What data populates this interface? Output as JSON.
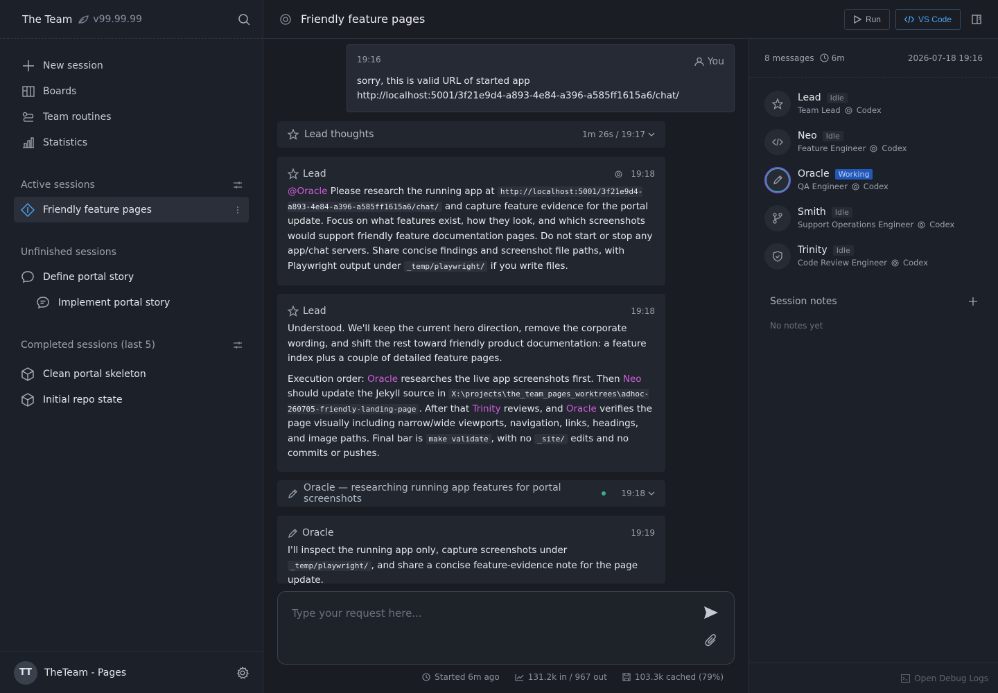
{
  "sidebar": {
    "brand": "The Team",
    "version": "v99.99.99",
    "nav": [
      {
        "label": "New session"
      },
      {
        "label": "Boards"
      },
      {
        "label": "Team routines"
      },
      {
        "label": "Statistics"
      }
    ],
    "active_title": "Active sessions",
    "active_items": [
      {
        "label": "Friendly feature pages"
      }
    ],
    "unfinished_title": "Unfinished sessions",
    "unfinished_items": [
      {
        "label": "Define portal story"
      },
      {
        "label": "Implement portal story"
      }
    ],
    "completed_title": "Completed sessions (last 5)",
    "completed_items": [
      {
        "label": "Clean portal skeleton"
      },
      {
        "label": "Initial repo state"
      }
    ],
    "footer": {
      "logo_text": "TT",
      "project": "TheTeam - Pages"
    }
  },
  "topbar": {
    "title": "Friendly feature pages",
    "run_label": "Run",
    "vscode_label": "VS Code"
  },
  "chat": {
    "user_msg": {
      "time": "19:16",
      "author": "You",
      "line1": "sorry, this is valid URL of started app",
      "line2": "http://localhost:5001/3f21e9d4-a893-4e84-a396-a585ff1615a6/chat/"
    },
    "lead_thoughts": {
      "label": "Lead thoughts",
      "meta": "1m 26s / 19:17"
    },
    "msg1": {
      "author": "Lead",
      "time": "19:18",
      "mention": "@Oracle",
      "t1": " Please research the running app at ",
      "code1": "http://localhost:5001/3f21e9d4-a893-4e84-a396-a585ff1615a6/chat/",
      "t2": " and capture feature evidence for the portal update. Focus on what features exist, how they look, and which screenshots would support friendly feature documentation pages. Do not start or stop any app/chat servers. Share concise findings and screenshot file paths, with Playwright output under ",
      "code2": "_temp/playwright/",
      "t3": " if you write files."
    },
    "msg2": {
      "author": "Lead",
      "time": "19:18",
      "p1": "Understood. We'll keep the current hero direction, remove the corporate wording, and shift the rest toward friendly product documentation: a feature index plus a couple of detailed feature pages.",
      "t1": "Execution order: ",
      "m1": "Oracle",
      "t2": " researches the live app screenshots first. Then ",
      "m2": "Neo",
      "t3": " should update the Jekyll source in ",
      "code1": "X:\\projects\\the_team_pages_worktrees\\adhoc-260705-friendly-landing-page",
      "t4": ". After that ",
      "m3": "Trinity",
      "t5": " reviews, and ",
      "m4": "Oracle",
      "t6": " verifies the page visually including narrow/wide viewports, navigation, links, headings, and image paths. Final bar is ",
      "code2": "make validate",
      "t7": ", with no ",
      "code3": "_site/",
      "t8": " edits and no commits or pushes."
    },
    "oracle_status": {
      "label": "Oracle — researching running app features for portal screenshots",
      "time": "19:18"
    },
    "msg3": {
      "author": "Oracle",
      "time": "19:19",
      "t1": "I'll inspect the running app only, capture screenshots under ",
      "code1": "_temp/playwright/",
      "t2": ", and share a concise feature-evidence note for the page update."
    },
    "composer_placeholder": "Type your request here...",
    "footer": {
      "started": "Started 6m ago",
      "tokens": "131.2k in / 967 out",
      "cached": "103.3k cached (79%)"
    }
  },
  "right": {
    "messages": "8 messages",
    "duration": "6m",
    "date": "2026-07-18 19:16",
    "agents": [
      {
        "name": "Lead",
        "status": "Idle",
        "role": "Team Lead",
        "model": "Codex",
        "icon": "star-icon"
      },
      {
        "name": "Neo",
        "status": "Idle",
        "role": "Feature Engineer",
        "model": "Codex",
        "icon": "code-icon"
      },
      {
        "name": "Oracle",
        "status": "Working",
        "role": "QA Engineer",
        "model": "Codex",
        "icon": "pencil-icon"
      },
      {
        "name": "Smith",
        "status": "Idle",
        "role": "Support Operations Engineer",
        "model": "Codex",
        "icon": "branch-icon"
      },
      {
        "name": "Trinity",
        "status": "Idle",
        "role": "Code Review Engineer",
        "model": "Codex",
        "icon": "shield-icon"
      }
    ],
    "notes_title": "Session notes",
    "notes_empty": "No notes yet",
    "debug_label": "Open Debug Logs"
  }
}
